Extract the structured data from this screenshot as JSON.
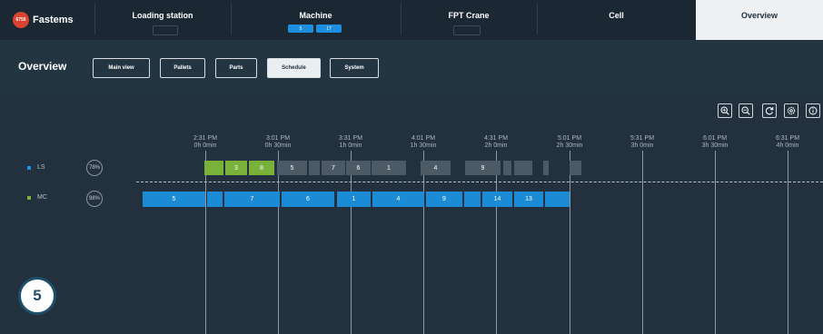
{
  "brand": {
    "badge": "6750",
    "name": "Fastems"
  },
  "nav": {
    "tabs": [
      {
        "label": "Loading station"
      },
      {
        "label": "Machine",
        "badges": [
          "5",
          "17"
        ]
      },
      {
        "label": "FPT Crane"
      },
      {
        "label": "Cell"
      },
      {
        "label": "Overview",
        "active": true
      }
    ]
  },
  "page": {
    "title": "Overview"
  },
  "views": [
    {
      "label": "Main view"
    },
    {
      "label": "Pallets"
    },
    {
      "label": "Parts"
    },
    {
      "label": "Schedule",
      "active": true
    },
    {
      "label": "System"
    }
  ],
  "tools": [
    "zoom-in-icon",
    "zoom-out-icon",
    "refresh-icon",
    "settings-icon",
    "info-icon"
  ],
  "timeline": {
    "ticks": [
      {
        "time": "2:31 PM",
        "elapsed": "0h 0min"
      },
      {
        "time": "3:01 PM",
        "elapsed": "0h 30min"
      },
      {
        "time": "3:31 PM",
        "elapsed": "1h 0min"
      },
      {
        "time": "4:01 PM",
        "elapsed": "1h 30min"
      },
      {
        "time": "4:31 PM",
        "elapsed": "2h 0min"
      },
      {
        "time": "5:01 PM",
        "elapsed": "2h 30min"
      },
      {
        "time": "5:31 PM",
        "elapsed": "3h 0min"
      },
      {
        "time": "6:01 PM",
        "elapsed": "3h 30min"
      },
      {
        "time": "6:31 PM",
        "elapsed": "4h 0min"
      }
    ]
  },
  "rows": [
    {
      "name": "LS",
      "utilization": "78%",
      "color": "#1e8fe0"
    },
    {
      "name": "MC",
      "utilization": "98%",
      "color": "#7ab13a"
    }
  ],
  "ls_blocks": [
    {
      "label": "",
      "color": "green"
    },
    {
      "label": "3",
      "color": "green"
    },
    {
      "label": "8",
      "color": "green"
    },
    {
      "label": "5",
      "color": "gray"
    },
    {
      "label": "",
      "color": "gray"
    },
    {
      "label": "7",
      "color": "gray"
    },
    {
      "label": "6",
      "color": "gray"
    },
    {
      "label": "1",
      "color": "gray"
    },
    {
      "label": "4",
      "color": "gray"
    },
    {
      "label": "9",
      "color": "gray"
    },
    {
      "label": "",
      "color": "gray"
    },
    {
      "label": "",
      "color": "gray"
    },
    {
      "label": "",
      "color": "gray"
    },
    {
      "label": "",
      "color": "gray"
    }
  ],
  "mc_blocks": [
    {
      "label": "5"
    },
    {
      "label": ""
    },
    {
      "label": "7"
    },
    {
      "label": "6"
    },
    {
      "label": "1"
    },
    {
      "label": "4"
    },
    {
      "label": "9"
    },
    {
      "label": ""
    },
    {
      "label": "14"
    },
    {
      "label": "13"
    },
    {
      "label": ""
    }
  ],
  "step": "5",
  "colors": {
    "green": "#7ab13a",
    "gray": "#4c5a65",
    "blue": "#1b8bd6",
    "brand": "#d9432f"
  }
}
